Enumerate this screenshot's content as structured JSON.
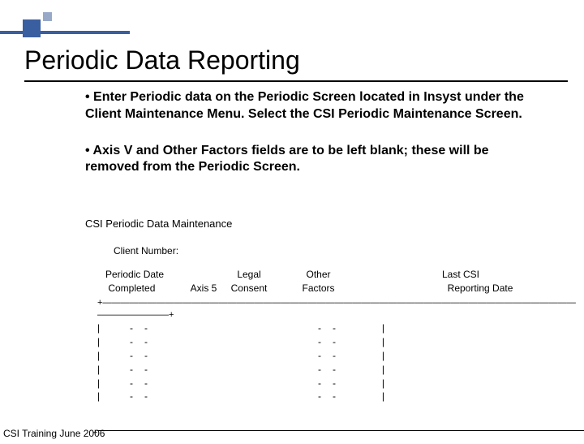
{
  "title": "Periodic Data Reporting",
  "bullets": [
    "Enter Periodic data on the Periodic Screen located in Insyst under the Client Maintenance Menu.   Select the CSI Periodic Maintenance Screen.",
    "Axis V and Other Factors fields are to be left blank; these will be removed from the Periodic Screen."
  ],
  "subhead": "CSI Periodic Data Maintenance",
  "client_label": "Client Number:",
  "columns": {
    "c1_line1": "Periodic Date",
    "c1_line2": " Completed",
    "c2_line1": "",
    "c2_line2": "Axis 5",
    "c3_line1": "Legal",
    "c3_line2": "Consent",
    "c4_line1": "Other",
    "c4_line2": "Factors",
    "c5_line1": "Last CSI",
    "c5_line2": "  Reporting Date"
  },
  "chart_data": {
    "type": "table",
    "columns": [
      "Periodic Date Completed",
      "Axis 5",
      "Legal Consent",
      "Other Factors",
      "Last CSI Reporting Date"
    ],
    "rows": [
      [
        "-",
        "-",
        "",
        "-",
        "-"
      ],
      [
        "-",
        "-",
        "",
        "-",
        "-"
      ],
      [
        "-",
        "-",
        "",
        "-",
        "-"
      ],
      [
        "-",
        "-",
        "",
        "-",
        "-"
      ],
      [
        "-",
        "-",
        "",
        "-",
        "-"
      ],
      [
        "-",
        "-",
        "",
        "-",
        "-"
      ]
    ]
  },
  "rule_top": "+————————————————————————————————————————————————————————————————————————————————",
  "rule_tail": "————————+",
  "pipe": "|",
  "dash": "-",
  "footer": "CSI Training June 2006",
  "foot_plus": "+"
}
